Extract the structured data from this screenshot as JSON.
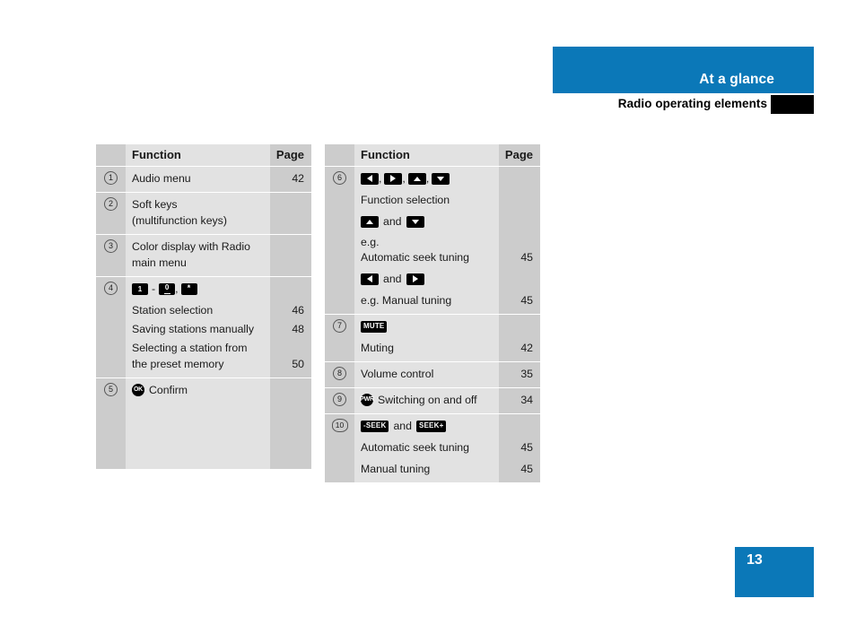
{
  "header": {
    "band_title": "At a glance",
    "sub_title": "Radio operating elements"
  },
  "footer": {
    "page_number": "13"
  },
  "colors": {
    "accent_blue": "#0b78b8",
    "table_bg": "#e2e2e2",
    "table_col_bg": "#cccccc",
    "key_black": "#000000"
  },
  "tables": {
    "left": {
      "columns": {
        "index": "",
        "function": "Function",
        "page": "Page"
      },
      "rows": [
        {
          "index": "1",
          "lines": [
            {
              "text": "Audio menu",
              "page": "42"
            }
          ]
        },
        {
          "index": "2",
          "lines": [
            {
              "text": "Soft keys",
              "page": ""
            },
            {
              "text": "(multifunction keys)",
              "page": ""
            }
          ]
        },
        {
          "index": "3",
          "lines": [
            {
              "text": "Color display with Radio",
              "page": ""
            },
            {
              "text": "main menu",
              "page": ""
            }
          ]
        },
        {
          "index": "4",
          "keys": [
            {
              "type": "num",
              "label": "1"
            },
            {
              "type": "dash",
              "label": "-"
            },
            {
              "type": "num-underscore",
              "label": "0"
            },
            {
              "type": "comma",
              "label": ","
            },
            {
              "type": "star",
              "label": "*"
            }
          ],
          "lines": [
            {
              "text": "Station selection",
              "page": "46"
            },
            {
              "text": "Saving stations manually",
              "page": "48"
            },
            {
              "text": "Selecting a station from",
              "page": ""
            },
            {
              "text": "the preset memory",
              "page": "50"
            }
          ]
        },
        {
          "index": "5",
          "icon": "ok-button-icon",
          "icon_label": "OK",
          "lines": [
            {
              "text": "Confirm",
              "page": ""
            }
          ]
        }
      ]
    },
    "right": {
      "columns": {
        "index": "",
        "function": "Function",
        "page": "Page"
      },
      "rows": [
        {
          "index": "6",
          "keys": [
            {
              "type": "arrow-left"
            },
            {
              "type": "comma",
              "label": ","
            },
            {
              "type": "arrow-right"
            },
            {
              "type": "comma",
              "label": ","
            },
            {
              "type": "arrow-up"
            },
            {
              "type": "comma",
              "label": ","
            },
            {
              "type": "arrow-down"
            }
          ],
          "lines": [
            {
              "text": "Function selection",
              "page": ""
            }
          ],
          "group2_prefix": "and",
          "group2": [
            {
              "type": "arrow-up"
            },
            {
              "type": "arrow-down"
            }
          ],
          "group2_lines": [
            {
              "text": "e.g.",
              "page": ""
            },
            {
              "text": "Automatic seek tuning",
              "page": "45"
            }
          ],
          "group3": [
            {
              "type": "arrow-left"
            },
            {
              "type": "arrow-right"
            }
          ],
          "group3_lines": [
            {
              "text": "e.g. Manual tuning",
              "page": "45"
            }
          ]
        },
        {
          "index": "7",
          "keys": [
            {
              "type": "label",
              "label": "MUTE"
            }
          ],
          "lines": [
            {
              "text": "Muting",
              "page": "42"
            }
          ]
        },
        {
          "index": "8",
          "lines": [
            {
              "text": "Volume control",
              "page": "35"
            }
          ]
        },
        {
          "index": "9",
          "icon": "power-button-icon",
          "icon_label": "PWR",
          "lines": [
            {
              "text": "Switching on and off",
              "page": "34"
            }
          ]
        },
        {
          "index": "10",
          "keys": [
            {
              "type": "label",
              "label": "-SEEK"
            },
            {
              "type": "and",
              "label": "and"
            },
            {
              "type": "label",
              "label": "SEEK+"
            }
          ],
          "lines": [
            {
              "text": "Automatic seek tuning",
              "page": "45"
            },
            {
              "text": "Manual tuning",
              "page": "45"
            }
          ]
        }
      ]
    }
  }
}
